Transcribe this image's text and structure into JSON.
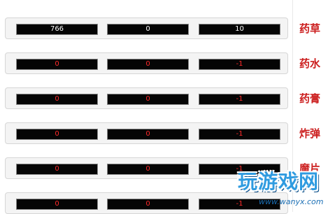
{
  "rows": [
    {
      "label": "药草",
      "values": [
        "766",
        "0",
        "10"
      ],
      "value_color": "#ffffff"
    },
    {
      "label": "药水",
      "values": [
        "0",
        "0",
        "-1"
      ],
      "value_color": "#ff2a2a"
    },
    {
      "label": "药膏",
      "values": [
        "0",
        "0",
        "-1"
      ],
      "value_color": "#ff2a2a"
    },
    {
      "label": "炸弹",
      "values": [
        "0",
        "0",
        "-1"
      ],
      "value_color": "#ff2a2a"
    },
    {
      "label": "魔片",
      "values": [
        "0",
        "0",
        "-1"
      ],
      "value_color": "#ff2a2a"
    },
    {
      "label": "",
      "values": [
        "0",
        "0",
        "-1"
      ],
      "value_color": "#ff2a2a"
    }
  ],
  "watermark": {
    "text": "玩游戏网",
    "url": "www.wanyx.com"
  },
  "colors": {
    "label": "#cc1f1f",
    "cell_bg": "#050505",
    "row_bg": "#f4f4f4"
  }
}
